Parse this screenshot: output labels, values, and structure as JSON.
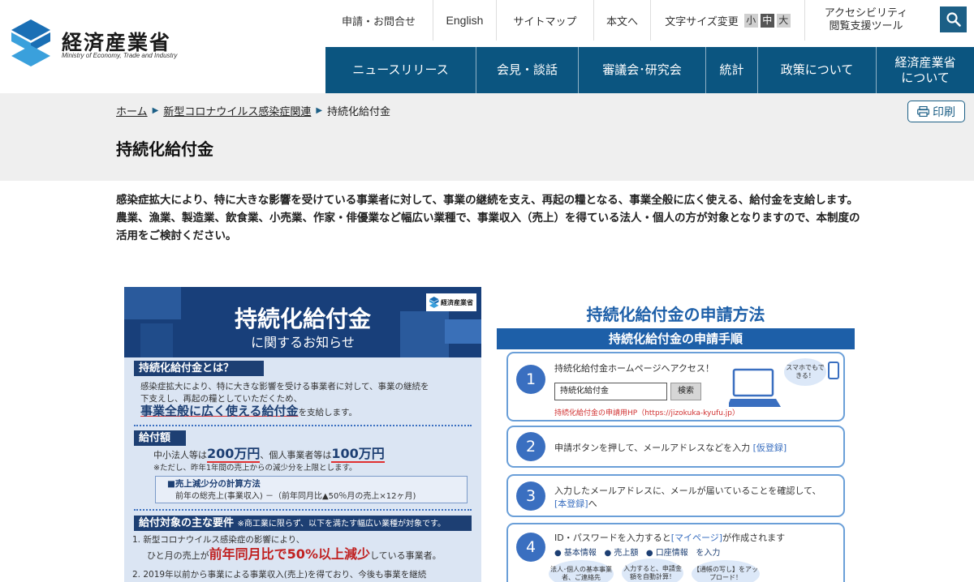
{
  "header": {
    "logo_title": "経済産業省",
    "logo_sub": "Ministry of Economy, Trade and Industry",
    "util": {
      "contact": "申請・お問合せ",
      "english": "English",
      "sitemap": "サイトマップ",
      "main_text": "本文へ",
      "font_size": "文字サイズ変更",
      "fs_small": "小",
      "fs_mid": "中",
      "fs_big": "大",
      "accessibility_line1": "アクセシビリティ",
      "accessibility_line2": "閲覧支援ツール"
    },
    "search_icon": "search-icon",
    "gnav": {
      "news": "ニュースリリース",
      "press": "会見・談話",
      "council": "審議会･研究会",
      "stats": "統計",
      "policy": "政策について",
      "about_line1": "経済産業省",
      "about_line2": "について"
    }
  },
  "breadcrumb": {
    "home": "ホーム",
    "corona": "新型コロナウイルス感染症関連",
    "current": "持続化給付金"
  },
  "print_label": "印刷",
  "page_title": "持続化給付金",
  "intro": {
    "p1": "感染症拡大により、特に大きな影響を受けている事業者に対して、事業の継続を支え、再起の糧となる、事業全般に広く使える、給付金を支給します。",
    "p2": "農業、漁業、製造業、飲食業、小売業、作家・俳優業など幅広い業種で、事業収入（売上）を得ている法人・個人の方が対象となりますので、本制度の活用をご検討ください。"
  },
  "flyer_left": {
    "logo": "経済産業省",
    "title": "持続化給付金",
    "subtitle": "に関するお知らせ",
    "what_heading": "持続化給付金とは？",
    "what_line1": "感染症拡大により、特に大きな影響を受ける事業者に対して、事業の継続を",
    "what_line2": "下支えし、再起の糧としていただくため、",
    "what_emph": "事業全般に広く使える給付金",
    "what_tail": "を支給します。",
    "amount_heading": "給付額",
    "amount_pre": "中小法人等は",
    "amount_corp": "200万円",
    "amount_mid": "、個人事業者等は",
    "amount_indiv": "100万円",
    "amount_note": "※ただし、昨年1年間の売上からの減少分を上限とします。",
    "calc_title": "■売上減少分の計算方法",
    "calc_formula": "前年の総売上(事業収入) －（前年同月比▲50％月の売上×12ヶ月)",
    "req_heading": "給付対象の主な要件",
    "req_note": "※商工業に限らず、以下を満たす幅広い業種が対象です。",
    "req1_line1": "1. 新型コロナウイルス感染症の影響により、",
    "req1_pre": "ひと月の売上が",
    "req1_emph": "前年同月比で50%以上減少",
    "req1_tail": "している事業者。",
    "req2_line1": "2. 2019年以前から事業による事業収入(売上)を得ており、今後も事業を継続"
  },
  "flyer_right": {
    "title": "持続化給付金の申請方法",
    "bar": "持続化給付金の申請手順",
    "step1_num": "1",
    "step1_text": "持続化給付金ホームページへアクセス！",
    "step1_input": "持続化給付金",
    "step1_button": "検索",
    "step1_url": "持続化給付金の申請用HP（https://jizokuka-kyufu.jp）",
    "step1_bubble": "スマホでもできる！",
    "step2_num": "2",
    "step2_pre": "申請ボタンを押して、メールアドレスなどを入力",
    "step2_link": "[仮登録]",
    "step3_num": "3",
    "step3_line1": "入力したメールアドレスに、メールが届いていることを確認して、",
    "step3_link": "[本登録]",
    "step3_tail": "へ",
    "step4_num": "4",
    "step4_pre": "ID・パスワードを入力すると",
    "step4_link": "[マイページ]",
    "step4_tail": "が作成されます",
    "step4_item1": "● 基本情報",
    "step4_item2": "● 売上額",
    "step4_item3": "● 口座情報",
    "step4_item_tail": "を入力",
    "bubble1": "法人･個人の基本事業者、ご連絡先",
    "bubble2": "入力すると、申請金額を自動計算！",
    "bubble3": "【通帳の写し】をアップロード！"
  },
  "colors": {
    "nav_bg": "#0b5580",
    "accent": "#1c5f86",
    "band_bg": "#efefef",
    "flyer_dark": "#183f7a",
    "flyer_light": "#dbe5f3",
    "step_blue": "#3a6fc0",
    "emphasis_red": "#e03030"
  }
}
